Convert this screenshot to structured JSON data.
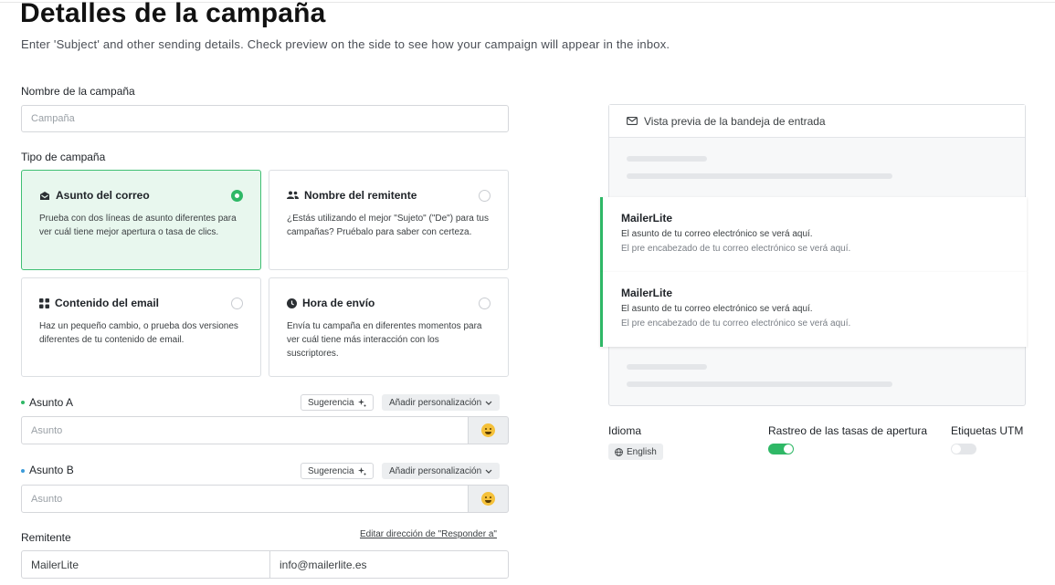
{
  "page": {
    "title": "Detalles de la campaña",
    "subtitle": "Enter 'Subject' and other sending details. Check preview on the side to see how your campaign will appear in the inbox."
  },
  "campaign_name": {
    "label": "Nombre de la campaña",
    "placeholder": "Campaña"
  },
  "campaign_type": {
    "label": "Tipo de campaña",
    "options": [
      {
        "title": "Asunto del correo",
        "desc": "Prueba con dos líneas de asunto diferentes para ver cuál tiene mejor apertura o tasa de clics.",
        "selected": true,
        "icon": "inbox-icon"
      },
      {
        "title": "Nombre del remitente",
        "desc": "¿Estás utilizando el mejor \"Sujeto\" (\"De\") para tus campañas? Pruébalo para saber con certeza.",
        "selected": false,
        "icon": "users-icon"
      },
      {
        "title": "Contenido del email",
        "desc": "Haz un pequeño cambio, o prueba dos versiones diferentes de tu contenido de email.",
        "selected": false,
        "icon": "grid-icon"
      },
      {
        "title": "Hora de envío",
        "desc": "Envía tu campaña en diferentes momentos para ver cuál tiene más interacción con los suscriptores.",
        "selected": false,
        "icon": "clock-icon"
      }
    ]
  },
  "subject_a": {
    "label": "Asunto A",
    "placeholder": "Asunto",
    "suggestion": "Sugerencia",
    "personalize": "Añadir personalización"
  },
  "subject_b": {
    "label": "Asunto B",
    "placeholder": "Asunto",
    "suggestion": "Sugerencia",
    "personalize": "Añadir personalización"
  },
  "sender": {
    "label": "Remitente",
    "reply_link": "Editar dirección de \"Responder a\"",
    "name": "MailerLite",
    "email": "info@mailerlite.es"
  },
  "preview": {
    "title": "Vista previa de la bandeja de entrada",
    "emails": [
      {
        "from": "MailerLite",
        "subject": "El asunto de tu correo electrónico se verá aquí.",
        "preheader": "El pre encabezado de tu correo electrónico se verá aquí."
      },
      {
        "from": "MailerLite",
        "subject": "El asunto de tu correo electrónico se verá aquí.",
        "preheader": "El pre encabezado de tu correo electrónico se verá aquí."
      }
    ]
  },
  "settings": {
    "language_label": "Idioma",
    "language_value": "English",
    "open_tracking_label": "Rastreo de las tasas de apertura",
    "open_tracking_on": true,
    "utm_label": "Etiquetas UTM",
    "utm_on": false
  },
  "colors": {
    "accent": "#2fb866",
    "selected_bg": "#e8f7ee"
  }
}
